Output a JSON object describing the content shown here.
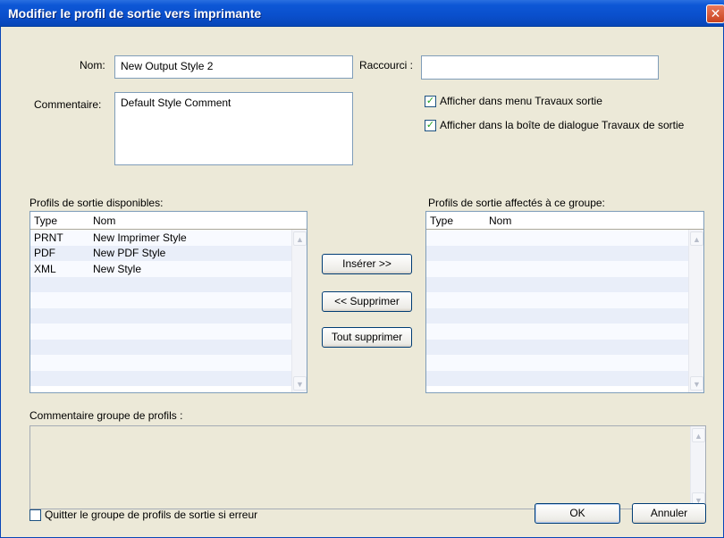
{
  "window": {
    "title": "Modifier le profil de sortie vers imprimante",
    "close_glyph": "✕"
  },
  "form": {
    "nom_label": "Nom:",
    "nom_value": "New  Output Style 2",
    "raccourci_label": "Raccourci :",
    "raccourci_value": "",
    "commentaire_label": "Commentaire:",
    "commentaire_value": "Default Style Comment",
    "show_menu_label": "Afficher dans menu Travaux sortie",
    "show_dialog_label": "Afficher dans la boîte de dialogue Travaux de sortie",
    "check_glyph": "✓"
  },
  "available": {
    "label": "Profils de sortie disponibles:",
    "col_type": "Type",
    "col_nom": "Nom",
    "rows": [
      {
        "type": "PRNT",
        "nom": "New Imprimer Style"
      },
      {
        "type": "PDF",
        "nom": "New PDF Style"
      },
      {
        "type": "XML",
        "nom": "New  Style"
      }
    ]
  },
  "assigned": {
    "label": "Profils de sortie affectés à ce groupe:",
    "col_type": "Type",
    "col_nom": "Nom"
  },
  "buttons": {
    "insert": "Insérer >>",
    "remove": "<< Supprimer",
    "remove_all": "Tout supprimer",
    "ok": "OK",
    "cancel": "Annuler"
  },
  "group_comment": {
    "label": "Commentaire groupe de profils :",
    "value": ""
  },
  "quit_on_error": {
    "label": "Quitter le groupe de profils de sortie si erreur",
    "checked": false
  },
  "icons": {
    "scroll_up": "▲",
    "scroll_down": "▼"
  },
  "colors": {
    "titlebar": "#0a4fcc",
    "dialog_bg": "#ece9d8",
    "check": "#21a121",
    "row_alt": "#e9eef9"
  }
}
